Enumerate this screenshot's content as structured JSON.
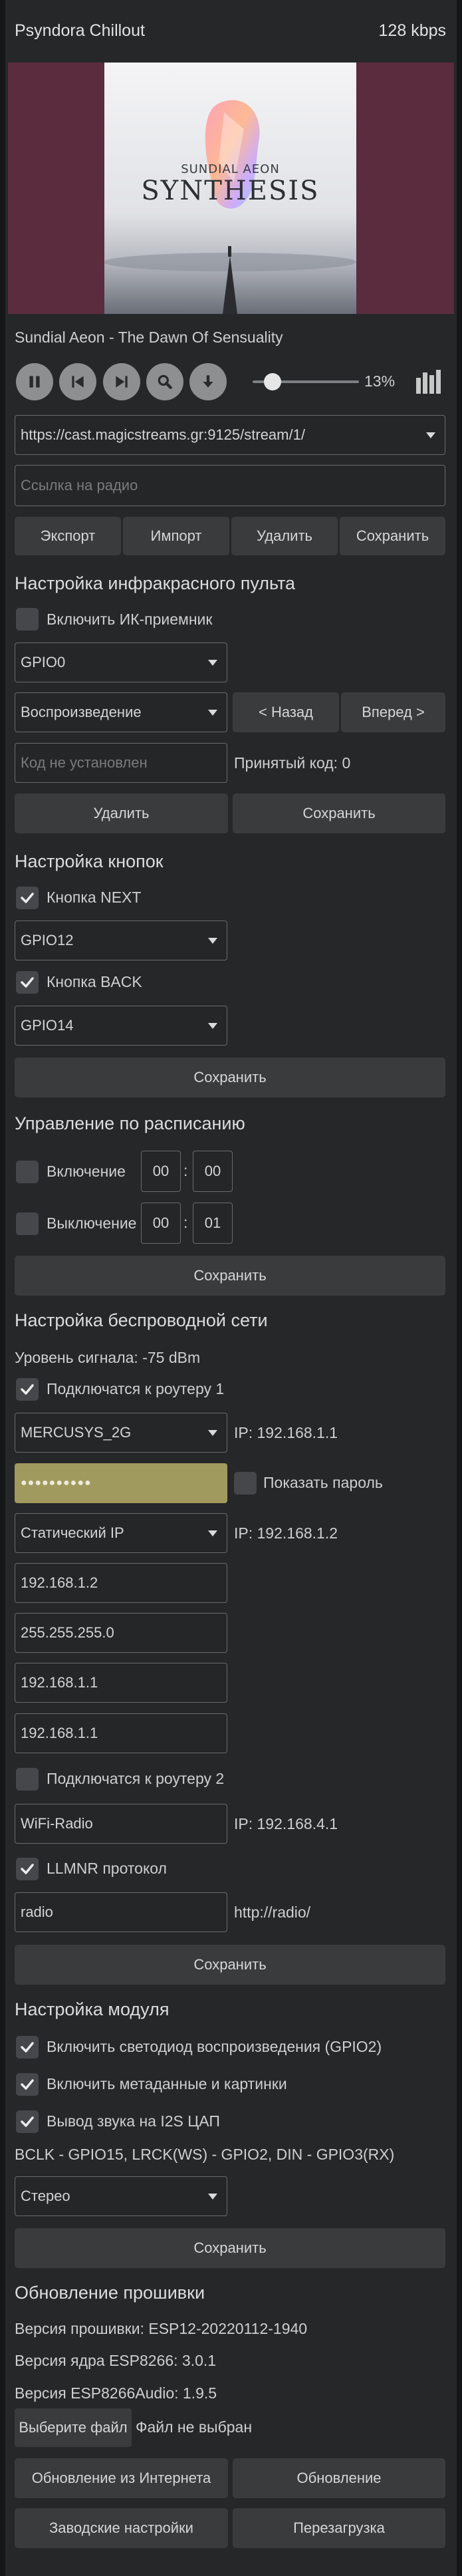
{
  "player": {
    "station_title": "Psyndora Chillout",
    "bitrate": "128 kbps",
    "cover_artist": "SUNDIAL AEON",
    "cover_title": "SYNTHESIS",
    "track": "Sundial Aeon - The Dawn Of Sensuality",
    "volume_label": "13%",
    "volume_level": 0.13
  },
  "station": {
    "url": "https://cast.magicstreams.gr:9125/stream/1/",
    "link_placeholder": "Ссылка на радио",
    "export": "Экспорт",
    "import": "Импорт",
    "delete": "Удалить",
    "save": "Сохранить"
  },
  "ir": {
    "title": "Настройка инфракрасного пульта",
    "enable_label": "Включить ИК-приемник",
    "enabled": false,
    "gpio": "GPIO0",
    "action": "Воспроизведение",
    "back": "< Назад",
    "forward": "Вперед >",
    "code_placeholder": "Код не установлен",
    "received_code": "Принятый код: 0",
    "delete": "Удалить",
    "save": "Сохранить"
  },
  "buttons": {
    "title": "Настройка кнопок",
    "next_label": "Кнопка NEXT",
    "next_checked": true,
    "next_gpio": "GPIO12",
    "back_label": "Кнопка BACK",
    "back_checked": true,
    "back_gpio": "GPIO14",
    "save": "Сохранить"
  },
  "schedule": {
    "title": "Управление по расписанию",
    "on_label": "Включение",
    "on_checked": false,
    "on_hour": "00",
    "on_min": "00",
    "off_label": "Выключение",
    "off_checked": false,
    "off_hour": "00",
    "off_min": "01",
    "sep": ":",
    "save": "Сохранить"
  },
  "wifi": {
    "title": "Настройка беспроводной сети",
    "signal": "Уровень сигнала: -75 dBm",
    "router1_label": "Подключатся к роутеру 1",
    "router1_checked": true,
    "ssid1": "MERCUSYS_2G",
    "ip1": "IP: 192.168.1.1",
    "password_mask": "●●●●●●●●●●",
    "show_password": "Показать пароль",
    "show_password_checked": false,
    "ip_mode": "Статический IP",
    "ip_mode_ip": "IP: 192.168.1.2",
    "static_ip": "192.168.1.2",
    "netmask": "255.255.255.0",
    "gateway": "192.168.1.1",
    "dns": "192.168.1.1",
    "router2_label": "Подключатся к роутеру 2",
    "router2_checked": false,
    "ssid2": "WiFi-Radio",
    "ip2": "IP: 192.168.4.1",
    "llmnr_label": "LLMNR протокол",
    "llmnr_checked": true,
    "hostname": "radio",
    "host_url": "http://radio/",
    "save": "Сохранить"
  },
  "module": {
    "title": "Настройка модуля",
    "led_label": "Включить светодиод воспроизведения (GPIO2)",
    "led_checked": true,
    "meta_label": "Включить метаданные и картинки",
    "meta_checked": true,
    "i2s_label": "Вывод звука на I2S ЦАП",
    "i2s_checked": true,
    "pins": "BCLK - GPIO15, LRCK(WS) - GPIO2, DIN - GPIO3(RX)",
    "mode": "Стерео",
    "save": "Сохранить"
  },
  "firmware": {
    "title": "Обновление прошивки",
    "fw_version": "Версия прошивки: ESP12-20220112-1940",
    "core_version": "Версия ядра ESP8266: 3.0.1",
    "audio_version": "Версия ESP8266Audio: 1.9.5",
    "choose_file": "Выберите файл",
    "no_file": "Файл не выбран",
    "update_internet": "Обновление из Интернета",
    "update": "Обновление",
    "factory_reset": "Заводские настройки",
    "reboot": "Перезагрузка"
  },
  "colors": {
    "background": "#262729",
    "page_margin": "#151617",
    "button": "#3a3b3d",
    "cover_side": "#5a2c3d",
    "password_field": "#a09a5e"
  }
}
